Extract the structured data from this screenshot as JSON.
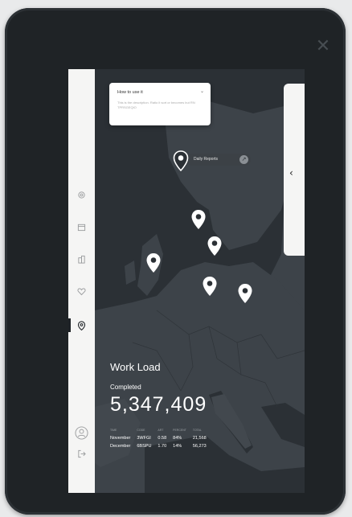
{
  "help_card": {
    "title": "How to use it",
    "text": "This is the description. Ratio it sort or becomes but RN TPRSGEQIO"
  },
  "daily_reports": {
    "label": "Daily Reports"
  },
  "workload": {
    "title": "Work Load",
    "completed_label": "Completed",
    "completed_value": "5,347,409",
    "columns": [
      "TIME",
      "CODE",
      "ART",
      "PERCENT",
      "TOTAL"
    ],
    "rows": [
      [
        "November",
        "3WFGI",
        "0.58",
        "84%",
        "21,568"
      ],
      [
        "December",
        "6BSPU",
        "1.70",
        "14%",
        "56,273"
      ]
    ]
  },
  "sidebar": {
    "items": [
      "gear-icon",
      "calendar-icon",
      "building-icon",
      "heart-icon",
      "location-pin-icon"
    ],
    "active": "location-pin-icon",
    "bottom": [
      "user-icon",
      "logout-icon"
    ]
  },
  "colors": {
    "map_land": "#3d4349",
    "map_sea": "#2b3035",
    "sidebar_bg": "#f5f5f4",
    "text_light": "#ffffff"
  }
}
